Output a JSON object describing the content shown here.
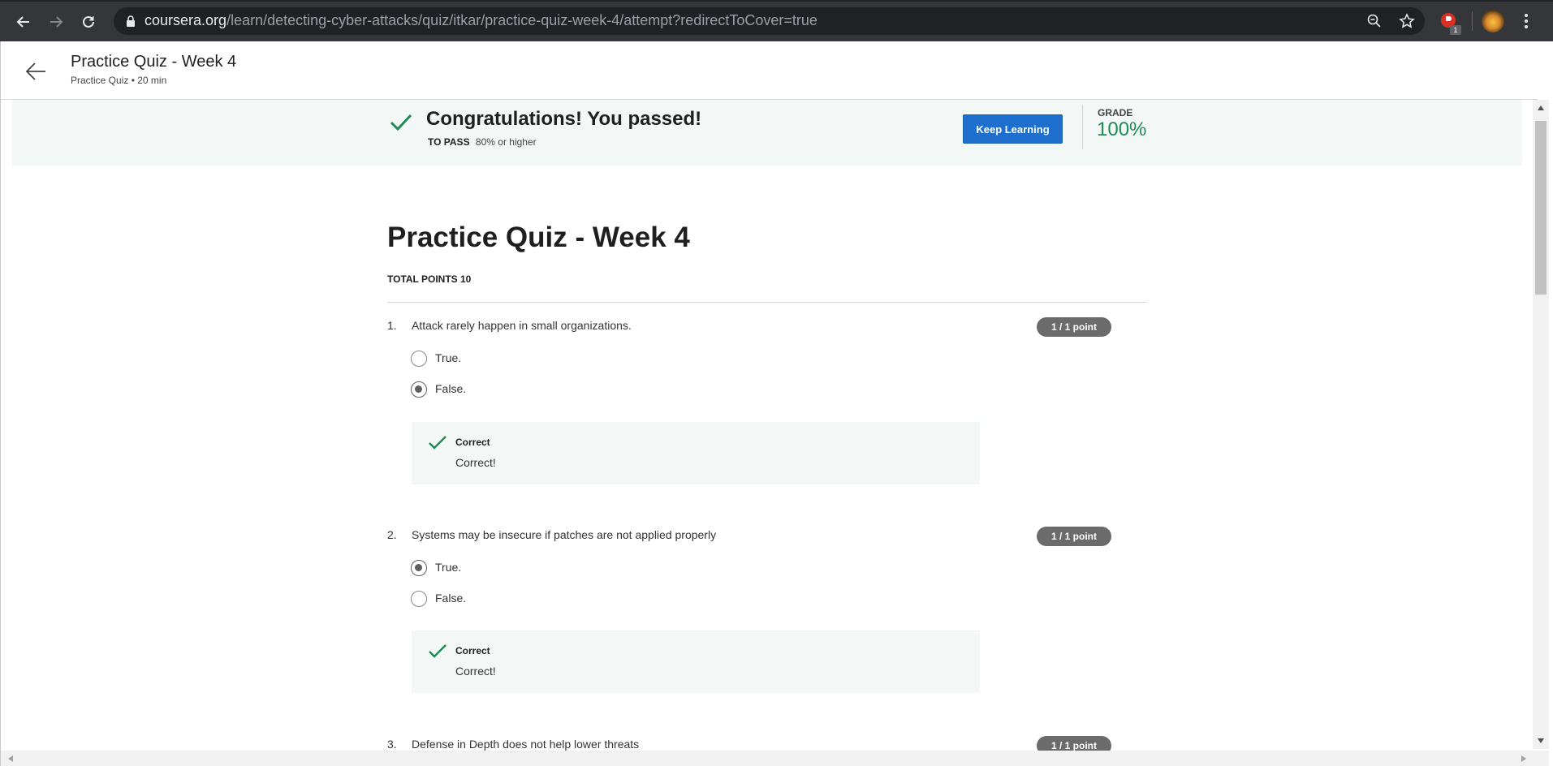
{
  "browser": {
    "url_host": "coursera.org",
    "url_path": "/learn/detecting-cyber-attacks/quiz/itkar/practice-quiz-week-4/attempt?redirectToCover=true",
    "extension_badge": "1"
  },
  "header": {
    "title": "Practice Quiz - Week 4",
    "subtitle": "Practice Quiz • 20 min"
  },
  "banner": {
    "message": "Congratulations! You passed!",
    "to_pass_label": "TO PASS",
    "to_pass_value": "80% or higher",
    "keep_learning": "Keep Learning",
    "grade_label": "GRADE",
    "grade_value": "100%"
  },
  "quiz": {
    "title": "Practice Quiz - Week 4",
    "total_points": "TOTAL POINTS 10",
    "questions": [
      {
        "number": "1.",
        "text": "Attack rarely happen in small organizations.",
        "points": "1 / 1 point",
        "options": [
          "True.",
          "False."
        ],
        "selected": 1,
        "feedback_title": "Correct",
        "feedback_text": "Correct!"
      },
      {
        "number": "2.",
        "text": "Systems may be insecure if patches are not applied properly",
        "points": "1 / 1 point",
        "options": [
          "True.",
          "False."
        ],
        "selected": 0,
        "feedback_title": "Correct",
        "feedback_text": "Correct!"
      },
      {
        "number": "3.",
        "text": "Defense in Depth does not help lower threats",
        "points": "1 / 1 point"
      }
    ]
  },
  "colors": {
    "accent_green": "#1e8b57",
    "button_blue": "#1f6fce",
    "banner_bg": "#f3f8f6"
  }
}
